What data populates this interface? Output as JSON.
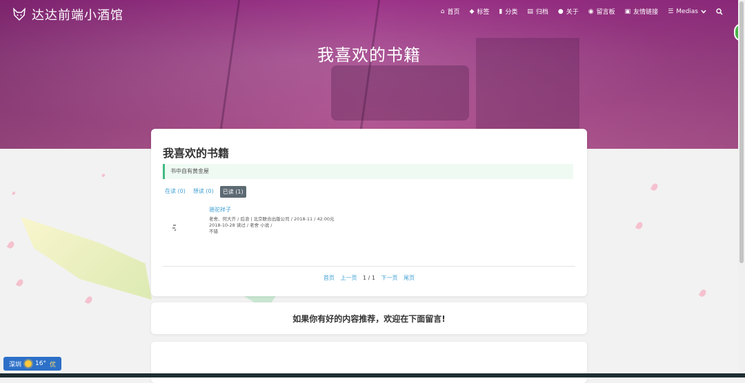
{
  "brand": {
    "name": "达达前端小酒馆"
  },
  "nav": [
    {
      "icon": "home-icon",
      "glyph": "⌂",
      "label": "首页"
    },
    {
      "icon": "tags-icon",
      "glyph": "◆",
      "label": "标签"
    },
    {
      "icon": "bookmark-icon",
      "glyph": "▮",
      "label": "分类"
    },
    {
      "icon": "archive-icon",
      "glyph": "▤",
      "label": "归档"
    },
    {
      "icon": "user-circle-icon",
      "glyph": "●",
      "label": "关于"
    },
    {
      "icon": "comments-icon",
      "glyph": "◉",
      "label": "留言板"
    },
    {
      "icon": "address-book-icon",
      "glyph": "▣",
      "label": "友情链接"
    },
    {
      "icon": "list-icon",
      "glyph": "☰",
      "label": "Medias"
    }
  ],
  "hero": {
    "title": "我喜欢的书籍"
  },
  "page": {
    "heading": "我喜欢的书籍",
    "quote": "书中自有黄金屋",
    "tabs": [
      {
        "label": "在读 (0)",
        "active": false
      },
      {
        "label": "想读 (0)",
        "active": false
      },
      {
        "label": "已读 (1)",
        "active": true
      }
    ],
    "book": {
      "title": "骆驼祥子",
      "meta": "老舍、何大齐 / 后浪 | 北京联合出版公司 / 2018-11 / 42.00元",
      "read": "2018-10-28 读过 / 老舍 小说 /",
      "comment": "不错"
    },
    "pager": {
      "first": "首页",
      "prev": "上一页",
      "current": "1 / 1",
      "next": "下一页",
      "last": "尾页"
    }
  },
  "recommend": {
    "text": "如果你有好的内容推荐，欢迎在下面留言!"
  },
  "weather": {
    "city": "深圳",
    "temp": "16°",
    "quality": "优"
  },
  "colors": {
    "accent": "#42b983",
    "link": "#42a1d4",
    "hero": "#9a2f86"
  }
}
